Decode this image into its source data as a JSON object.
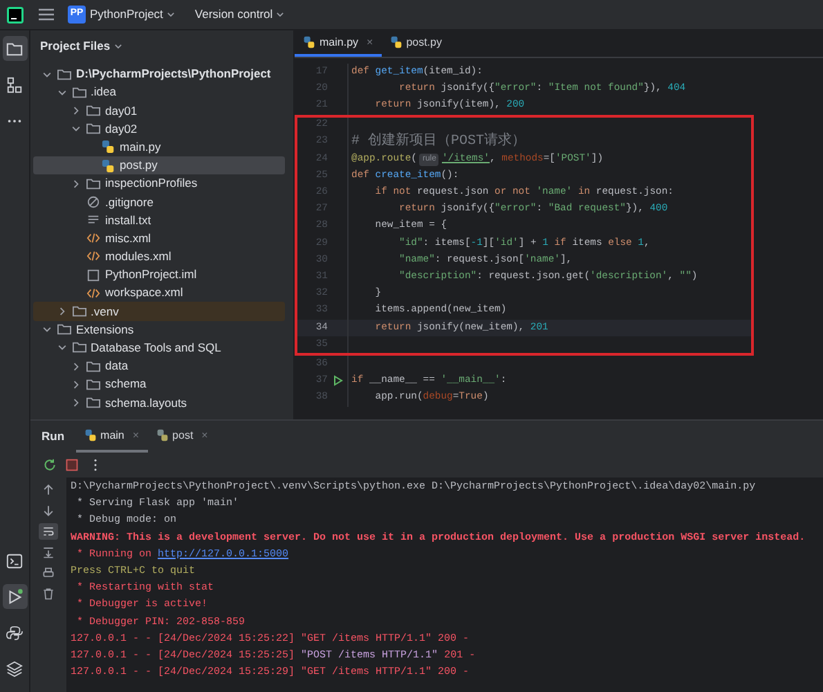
{
  "title_bar": {
    "project_badge": "PP",
    "project": "PythonProject",
    "vcs": "Version control"
  },
  "left_toolbar": {
    "top": [
      {
        "kind": "folder",
        "selected": true
      },
      {
        "kind": "structure",
        "selected": false
      },
      {
        "kind": "more",
        "selected": false
      }
    ],
    "bottom": [
      {
        "kind": "terminal",
        "selected": false
      },
      {
        "kind": "run",
        "selected": true
      },
      {
        "kind": "python",
        "selected": false
      },
      {
        "kind": "layers",
        "selected": false
      }
    ]
  },
  "project_panel": {
    "title": "Project Files",
    "tree": [
      {
        "label": "D:\\PycharmProjects\\PythonProject",
        "kind": "root",
        "expanded": true,
        "selected": false,
        "children": [
          {
            "label": ".idea",
            "kind": "folder",
            "expanded": true,
            "selected": false,
            "excluded": false,
            "children": [
              {
                "label": "day01",
                "kind": "folder",
                "expanded": false,
                "selected": false
              },
              {
                "label": "day02",
                "kind": "folder",
                "expanded": true,
                "selected": false,
                "children": [
                  {
                    "label": "main.py",
                    "kind": "py",
                    "selected": false
                  },
                  {
                    "label": "post.py",
                    "kind": "py",
                    "selected": true
                  }
                ]
              },
              {
                "label": "inspectionProfiles",
                "kind": "folder",
                "expanded": false,
                "selected": false
              },
              {
                "label": ".gitignore",
                "kind": "ignore",
                "selected": false
              },
              {
                "label": "install.txt",
                "kind": "text",
                "selected": false
              },
              {
                "label": "misc.xml",
                "kind": "xml",
                "selected": false
              },
              {
                "label": "modules.xml",
                "kind": "xml",
                "selected": false
              },
              {
                "label": "PythonProject.iml",
                "kind": "iml",
                "selected": false
              },
              {
                "label": "workspace.xml",
                "kind": "xml",
                "selected": false
              }
            ]
          },
          {
            "label": ".venv",
            "kind": "folder",
            "expanded": false,
            "selected": false,
            "excluded": true
          }
        ]
      },
      {
        "label": "Extensions",
        "kind": "folder",
        "expanded": true,
        "selected": false,
        "children": [
          {
            "label": "Database Tools and SQL",
            "kind": "folder",
            "expanded": true,
            "selected": false,
            "children": [
              {
                "label": "data",
                "kind": "folder",
                "expanded": false,
                "selected": false
              },
              {
                "label": "schema",
                "kind": "folder",
                "expanded": false,
                "selected": false
              },
              {
                "label": "schema.layouts",
                "kind": "folder",
                "expanded": false,
                "selected": false
              }
            ]
          }
        ]
      }
    ]
  },
  "editor": {
    "tabs": [
      {
        "label": "main.py",
        "selected": true,
        "close": "×"
      },
      {
        "label": "post.py",
        "selected": false
      }
    ],
    "blocks": [
      {
        "framed": false,
        "lines": [
          {
            "number": "17",
            "current": false,
            "run_marker": false,
            "tokens": [
              {
                "text": "def",
                "kind": "kw"
              },
              {
                "text": " get_item",
                "kind": "fn"
              },
              {
                "text": "(item_id):",
                "kind": "plain"
              }
            ]
          },
          {
            "number": "20",
            "current": false,
            "run_marker": false,
            "tokens": [
              {
                "text": "        return",
                "kind": "kw"
              },
              {
                "text": " jsonify({",
                "kind": "plain"
              },
              {
                "text": "\"error\"",
                "kind": "str"
              },
              {
                "text": ": ",
                "kind": "plain"
              },
              {
                "text": "\"Item not found\"",
                "kind": "str"
              },
              {
                "text": "}), ",
                "kind": "plain"
              },
              {
                "text": "404",
                "kind": "num"
              }
            ]
          },
          {
            "number": "21",
            "current": false,
            "run_marker": false,
            "tokens": [
              {
                "text": "    return",
                "kind": "kw"
              },
              {
                "text": " jsonify(item), ",
                "kind": "plain"
              },
              {
                "text": "200",
                "kind": "num"
              }
            ]
          }
        ]
      },
      {
        "framed": true,
        "lines": [
          {
            "number": "22",
            "current": false,
            "run_marker": false
          },
          {
            "number": "23",
            "current": false,
            "run_marker": false,
            "tokens": [
              {
                "text": "# 创建新项目（POST请求）",
                "kind": "comment"
              }
            ]
          },
          {
            "number": "24",
            "current": false,
            "run_marker": false,
            "tokens": [
              {
                "text": "@app.route",
                "kind": "deco"
              },
              {
                "text": "(",
                "kind": "plain"
              },
              {
                "text": "rule",
                "kind": "hint"
              },
              {
                "text": "'/items'",
                "kind": "link"
              },
              {
                "text": ", ",
                "kind": "plain"
              },
              {
                "text": "methods",
                "kind": "param"
              },
              {
                "text": "=[",
                "kind": "plain"
              },
              {
                "text": "'POST'",
                "kind": "str"
              },
              {
                "text": "])",
                "kind": "plain"
              }
            ]
          },
          {
            "number": "25",
            "current": false,
            "run_marker": false,
            "tokens": [
              {
                "text": "def",
                "kind": "kw"
              },
              {
                "text": " create_item",
                "kind": "fn"
              },
              {
                "text": "():",
                "kind": "plain"
              }
            ]
          },
          {
            "number": "26",
            "current": false,
            "run_marker": false,
            "tokens": [
              {
                "text": "    if not",
                "kind": "kw"
              },
              {
                "text": " request.json ",
                "kind": "plain"
              },
              {
                "text": "or not",
                "kind": "kw"
              },
              {
                "text": " 'name'",
                "kind": "str"
              },
              {
                "text": " in",
                "kind": "kw"
              },
              {
                "text": " request.json:",
                "kind": "plain"
              }
            ]
          },
          {
            "number": "27",
            "current": false,
            "run_marker": false,
            "tokens": [
              {
                "text": "        return",
                "kind": "kw"
              },
              {
                "text": " jsonify({",
                "kind": "plain"
              },
              {
                "text": "\"error\"",
                "kind": "str"
              },
              {
                "text": ": ",
                "kind": "plain"
              },
              {
                "text": "\"Bad request\"",
                "kind": "str"
              },
              {
                "text": "}), ",
                "kind": "plain"
              },
              {
                "text": "400",
                "kind": "num"
              }
            ]
          },
          {
            "number": "28",
            "current": false,
            "run_marker": false,
            "tokens": [
              {
                "text": "    new_item = {",
                "kind": "plain"
              }
            ]
          },
          {
            "number": "29",
            "current": false,
            "run_marker": false,
            "tokens": [
              {
                "text": "        \"id\"",
                "kind": "str"
              },
              {
                "text": ": items[",
                "kind": "plain"
              },
              {
                "text": "-1",
                "kind": "num"
              },
              {
                "text": "][",
                "kind": "plain"
              },
              {
                "text": "'id'",
                "kind": "str"
              },
              {
                "text": "] + ",
                "kind": "plain"
              },
              {
                "text": "1",
                "kind": "num"
              },
              {
                "text": " if",
                "kind": "kw"
              },
              {
                "text": " items ",
                "kind": "plain"
              },
              {
                "text": "else",
                "kind": "kw"
              },
              {
                "text": " 1",
                "kind": "num"
              },
              {
                "text": ",",
                "kind": "plain"
              }
            ]
          },
          {
            "number": "30",
            "current": false,
            "run_marker": false,
            "tokens": [
              {
                "text": "        \"name\"",
                "kind": "str"
              },
              {
                "text": ": request.json[",
                "kind": "plain"
              },
              {
                "text": "'name'",
                "kind": "str"
              },
              {
                "text": "],",
                "kind": "plain"
              }
            ]
          },
          {
            "number": "31",
            "current": false,
            "run_marker": false,
            "tokens": [
              {
                "text": "        \"description\"",
                "kind": "str"
              },
              {
                "text": ": request.json.get(",
                "kind": "plain"
              },
              {
                "text": "'description'",
                "kind": "str"
              },
              {
                "text": ", ",
                "kind": "plain"
              },
              {
                "text": "\"\"",
                "kind": "str"
              },
              {
                "text": ")",
                "kind": "plain"
              }
            ]
          },
          {
            "number": "32",
            "current": false,
            "run_marker": false,
            "tokens": [
              {
                "text": "    }",
                "kind": "plain"
              }
            ]
          },
          {
            "number": "33",
            "current": false,
            "run_marker": false,
            "tokens": [
              {
                "text": "    items.append(new_item)",
                "kind": "plain"
              }
            ]
          },
          {
            "number": "34",
            "current": true,
            "run_marker": false,
            "tokens": [
              {
                "text": "    return",
                "kind": "kw"
              },
              {
                "text": " jsonify(new_item), ",
                "kind": "plain"
              },
              {
                "text": "201",
                "kind": "num"
              }
            ]
          },
          {
            "number": "35",
            "current": false,
            "run_marker": false
          }
        ]
      },
      {
        "framed": false,
        "lines": [
          {
            "number": "36",
            "current": false,
            "run_marker": false
          },
          {
            "number": "37",
            "current": false,
            "run_marker": true,
            "tokens": [
              {
                "text": "if",
                "kind": "kw"
              },
              {
                "text": " __name__ == ",
                "kind": "plain"
              },
              {
                "text": "'__main__'",
                "kind": "str"
              },
              {
                "text": ":",
                "kind": "plain"
              }
            ]
          },
          {
            "number": "38",
            "current": false,
            "run_marker": false,
            "tokens": [
              {
                "text": "    app.run(",
                "kind": "plain"
              },
              {
                "text": "debug",
                "kind": "param"
              },
              {
                "text": "=",
                "kind": "plain"
              },
              {
                "text": "True",
                "kind": "kw"
              },
              {
                "text": ")",
                "kind": "plain"
              }
            ]
          }
        ]
      }
    ]
  },
  "run_panel": {
    "title": "Run",
    "tabs": [
      {
        "label": "main",
        "selected": true,
        "close": "×"
      },
      {
        "label": "post",
        "selected": false,
        "close": "×"
      }
    ],
    "console": [
      [
        {
          "text": "D:\\PycharmProjects\\PythonProject\\.venv\\Scripts\\python.exe D:\\PycharmProjects\\PythonProject\\.idea\\day02\\main.py",
          "kind": "plain"
        }
      ],
      [
        {
          "text": " * Serving Flask app 'main'",
          "kind": "plain"
        }
      ],
      [
        {
          "text": " * Debug mode: on",
          "kind": "plain"
        }
      ],
      [
        {
          "text": "WARNING: This is a development server. Do not use it in a production deployment. Use a production WSGI server instead.",
          "kind": "warning"
        }
      ],
      [
        {
          "text": " * Running on ",
          "kind": "error"
        },
        {
          "text": "http://127.0.0.1:5000",
          "kind": "link"
        }
      ],
      [
        {
          "text": "Press CTRL+C to quit",
          "kind": "note"
        }
      ],
      [
        {
          "text": " * Restarting with stat",
          "kind": "error"
        }
      ],
      [
        {
          "text": " * Debugger is active!",
          "kind": "error"
        }
      ],
      [
        {
          "text": " * Debugger PIN: 202-858-859",
          "kind": "error"
        }
      ],
      [
        {
          "text": "127.0.0.1 - - [24/Dec/2024 15:25:22] \"GET /items HTTP/1.1\" 200 -",
          "kind": "error"
        }
      ],
      [
        {
          "text": "127.0.0.1 - - [24/Dec/2024 15:25:25] ",
          "kind": "error"
        },
        {
          "text": "\"POST /items HTTP/1.1\"",
          "kind": "post"
        },
        {
          "text": " 201 -",
          "kind": "error"
        }
      ],
      [
        {
          "text": "127.0.0.1 - - [24/Dec/2024 15:25:29] \"GET /items HTTP/1.1\" 200 -",
          "kind": "error"
        }
      ]
    ]
  }
}
